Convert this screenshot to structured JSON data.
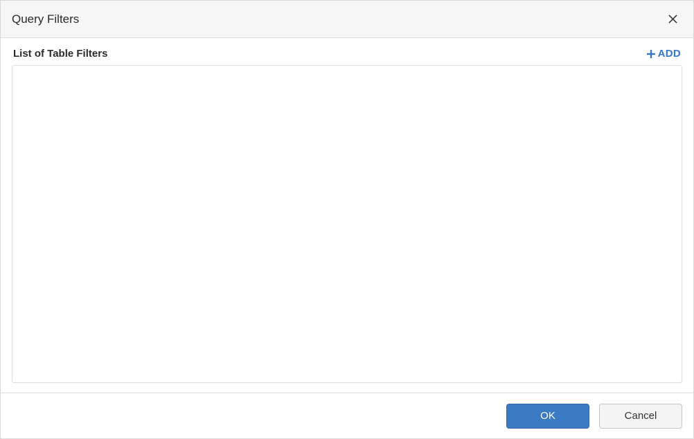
{
  "dialog": {
    "title": "Query Filters"
  },
  "body": {
    "list_title": "List of Table Filters",
    "add_label": "ADD"
  },
  "footer": {
    "ok_label": "OK",
    "cancel_label": "Cancel"
  }
}
